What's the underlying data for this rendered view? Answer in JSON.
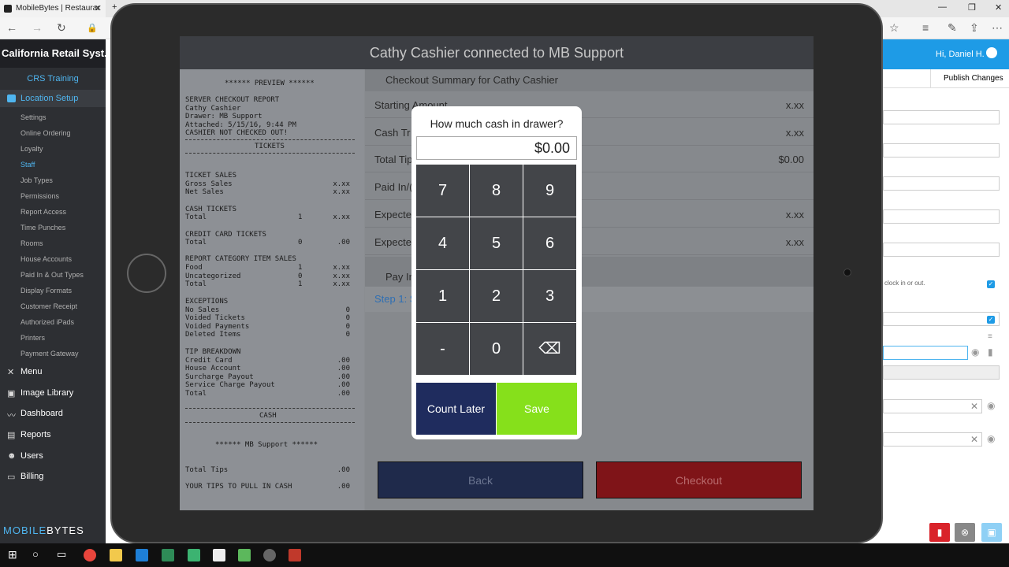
{
  "browser": {
    "tab_title": "MobileBytes | Restaurar",
    "tab_close": "✕",
    "new_tab": "+",
    "win_min": "—",
    "win_max": "❐",
    "win_close": "✕"
  },
  "sidebar": {
    "app_title": "California Retail Syst...",
    "training": "CRS Training",
    "section": "Location Setup",
    "subitems": [
      "Settings",
      "Online Ordering",
      "Loyalty",
      "Staff",
      "Job Types",
      "Permissions",
      "Report Access",
      "Time Punches",
      "Rooms",
      "House Accounts",
      "Paid In & Out Types",
      "Display Formats",
      "Customer Receipt",
      "Authorized iPads",
      "Printers",
      "Payment Gateway"
    ],
    "active_subitem": "Staff",
    "main_items": [
      "Menu",
      "Image Library",
      "Dashboard",
      "Reports",
      "Users",
      "Billing"
    ],
    "logo_mobile": "MOBILE",
    "logo_bytes": "BYTES"
  },
  "right": {
    "greeting": "Hi, Daniel H.",
    "publish": "Publish Changes",
    "clock_field": "clock in or out.",
    "check": "✓",
    "clear": "✕"
  },
  "screen": {
    "header": "Cathy Cashier connected to MB Support",
    "receipt": {
      "preview": "****** PREVIEW ******",
      "lines": [
        "SERVER CHECKOUT REPORT",
        "Cathy Cashier",
        "Drawer: MB Support",
        "Attached: 5/15/16, 9:44 PM",
        "CASHIER NOT CHECKED OUT!"
      ],
      "tickets_header": "TICKETS",
      "ticket_sales": "TICKET SALES",
      "gross_sales": "Gross Sales",
      "gross_val": "x.xx",
      "net_sales": "Net Sales",
      "net_val": "x.xx",
      "cash_tickets": "CASH TICKETS",
      "cash_total": "Total",
      "cash_count": "1",
      "cash_val": "x.xx",
      "cc_tickets": "CREDIT CARD TICKETS",
      "cc_total": "Total",
      "cc_count": "0",
      "cc_val": ".00",
      "rcis": "REPORT CATEGORY ITEM SALES",
      "food": "Food",
      "food_count": "1",
      "food_val": "x.xx",
      "uncat": "Uncategorized",
      "uncat_count": "0",
      "uncat_val": "x.xx",
      "rcis_total": "Total",
      "rcis_count": "1",
      "rcis_val": "x.xx",
      "exceptions": "EXCEPTIONS",
      "no_sales": "No Sales",
      "no_sales_val": "0",
      "voided_tickets": "Voided Tickets",
      "voided_tickets_val": "0",
      "voided_payments": "Voided Payments",
      "voided_payments_val": "0",
      "deleted_items": "Deleted Items",
      "deleted_items_val": "0",
      "tip_breakdown": "TIP BREAKDOWN",
      "tip_cc": "Credit Card",
      "tip_cc_val": ".00",
      "tip_house": "House Account",
      "tip_house_val": ".00",
      "tip_surcharge": "Surcharge Payout",
      "tip_surcharge_val": ".00",
      "tip_service": "Service Charge Payout",
      "tip_service_val": ".00",
      "tip_total": "Total",
      "tip_total_val": ".00",
      "cash_header": "CASH",
      "mb_support": "****** MB Support ******",
      "total_tips": "Total Tips",
      "total_tips_val": ".00",
      "tips_pull": "YOUR TIPS TO PULL IN CASH",
      "tips_pull_val": ".00"
    },
    "summary": {
      "title": "Checkout Summary for Cathy Cashier",
      "rows": [
        {
          "label": "Starting Amount",
          "value": "x.xx"
        },
        {
          "label": "Cash Tr",
          "value": "x.xx"
        },
        {
          "label": "Total Tip",
          "value": "$0.00"
        },
        {
          "label": "Paid In/(",
          "value": ""
        },
        {
          "label": "Expecte",
          "value": "x.xx"
        },
        {
          "label": "Expecte",
          "value": "x.xx"
        }
      ],
      "pay_in": "Pay In",
      "step": "Step 1: S",
      "back": "Back",
      "checkout": "Checkout"
    },
    "modal": {
      "question": "How much cash in drawer?",
      "amount": "$0.00",
      "keys": [
        "7",
        "8",
        "9",
        "4",
        "5",
        "6",
        "1",
        "2",
        "3",
        "-",
        "0",
        "⌫"
      ],
      "count_later": "Count Later",
      "save": "Save"
    }
  },
  "colors": {
    "accent": "#1e9be6",
    "save_green": "#86e01b",
    "navy": "#1f2c5e",
    "checkout_red": "#7f1418"
  }
}
